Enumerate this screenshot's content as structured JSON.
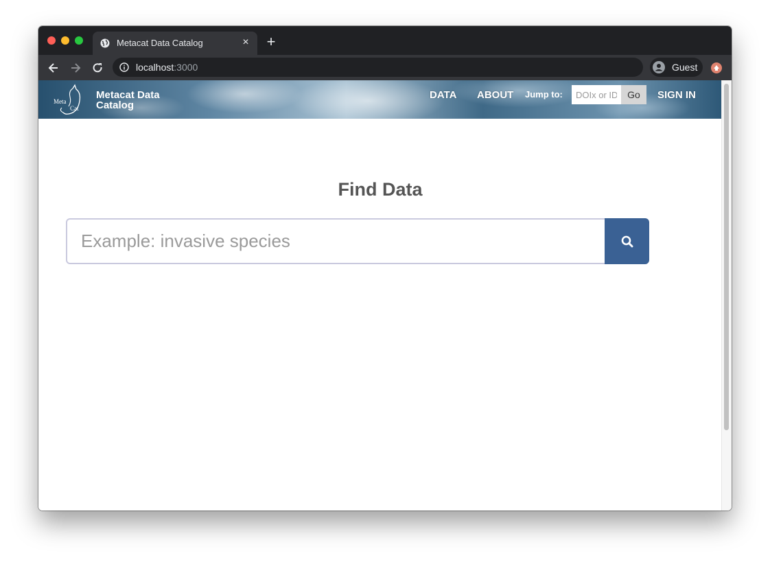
{
  "browser": {
    "tab": {
      "title": "Metacat Data Catalog",
      "favicon": "globe-icon",
      "close": "×"
    },
    "new_tab": "+",
    "address": {
      "host": "localhost",
      "port": ":3000"
    },
    "profile": {
      "name": "Guest"
    }
  },
  "header": {
    "site_title": "Metacat Data Catalog",
    "logo": {
      "line1": "Meta",
      "line2": "Cat"
    },
    "nav": {
      "data": "DATA",
      "about": "ABOUT",
      "signin": "SIGN IN"
    },
    "jump": {
      "label": "Jump to:",
      "placeholder": "DOIx or ID",
      "go": "Go"
    }
  },
  "main": {
    "title": "Find Data",
    "search": {
      "placeholder": "Example: invasive species",
      "icon": "search-icon"
    }
  },
  "colors": {
    "accent": "#3a6194",
    "tabstrip": "#202124",
    "toolbar": "#35363a",
    "title_text": "#555555"
  }
}
